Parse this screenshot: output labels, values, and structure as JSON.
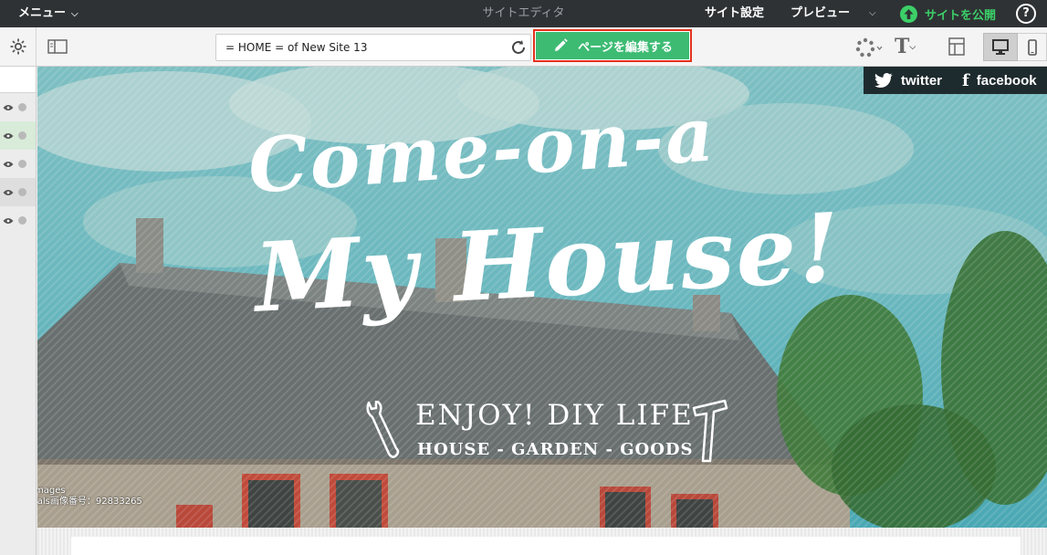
{
  "topbar": {
    "menu_label": "メニュー",
    "title": "サイトエディタ",
    "site_settings_label": "サイト設定",
    "preview_label": "プレビュー",
    "publish_label": "サイトを公開",
    "help_label": "?"
  },
  "toolbar": {
    "url_value": "= HOME = of New Site 13",
    "edit_page_label": "ページを編集する",
    "font_label": "T"
  },
  "hero": {
    "social": {
      "twitter_label": "twitter",
      "facebook_label": "facebook"
    },
    "headline_line1": "Come-on-a",
    "headline_line2": "My House!",
    "tagline_main": "ENJOY! DIY LIFE",
    "tagline_sub": "HOUSE - GARDEN - GOODS",
    "credit_line1": "mages",
    "credit_line2": "ials画像番号：92833265"
  },
  "colors": {
    "topbar_bg": "#2f3235",
    "publish_green": "#3ccf68",
    "edit_button_green": "#3dbb73",
    "highlight_red": "#e2331a",
    "social_bar_bg": "#1e2b2e"
  },
  "icons": [
    "chevron-down-icon",
    "upload-icon",
    "help-icon",
    "gear-icon",
    "sidebar-toggle-icon",
    "reload-icon",
    "pencil-icon",
    "theme-icon",
    "font-icon",
    "layout-icon",
    "desktop-icon",
    "mobile-icon",
    "eye-icon",
    "twitter-icon",
    "facebook-icon",
    "wrench-icon",
    "hammer-icon"
  ]
}
